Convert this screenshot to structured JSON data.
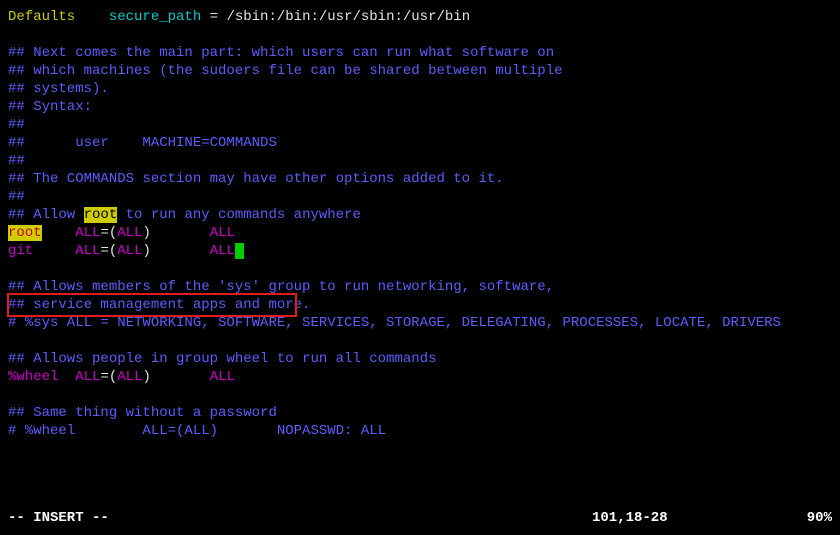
{
  "lines": {
    "l1_defaults": "Defaults",
    "l1_secure": "    secure_path ",
    "l1_eq": "= ",
    "l1_path": "/sbin:/bin:/usr/sbin:/usr/bin",
    "l3": "## Next comes the main part: which users can run what software on",
    "l4": "## which machines (the sudoers file can be shared between multiple",
    "l5": "## systems).",
    "l6": "## Syntax:",
    "l7": "##",
    "l8": "##      user    MACHINE=COMMANDS",
    "l9": "##",
    "l10": "## The COMMANDS section may have other options added to it.",
    "l11": "##",
    "l12a": "## Allow ",
    "l12_root": "root",
    "l12b": " to run any commands anywhere",
    "l13_root": "root",
    "l13_sp1": "    ",
    "l13_all1": "ALL",
    "l13_eq": "=(",
    "l13_all2": "ALL",
    "l13_close": ")       ",
    "l13_all3": "ALL",
    "l14_git": "git",
    "l14_sp1": "     ",
    "l14_all1": "ALL",
    "l14_eq": "=(",
    "l14_all2": "ALL",
    "l14_close": ")       ",
    "l14_all3": "ALL",
    "l16": "## Allows members of the 'sys' group to run networking, software,",
    "l17": "## service management apps and more.",
    "l18": "# %sys ALL = NETWORKING, SOFTWARE, SERVICES, STORAGE, DELEGATING, PROCESSES, LOCATE, DRIVERS",
    "l20": "## Allows people in group wheel to run all commands",
    "l21_wheel": "%wheel",
    "l21_sp1": "  ",
    "l21_all1": "ALL",
    "l21_eq": "=(",
    "l21_all2": "ALL",
    "l21_close": ")       ",
    "l21_all3": "ALL",
    "l23": "## Same thing without a password",
    "l24": "# %wheel        ALL=(ALL)       NOPASSWD: ALL"
  },
  "status": {
    "mode": "-- INSERT --",
    "pos": "101,18-28",
    "pct": "90%"
  }
}
